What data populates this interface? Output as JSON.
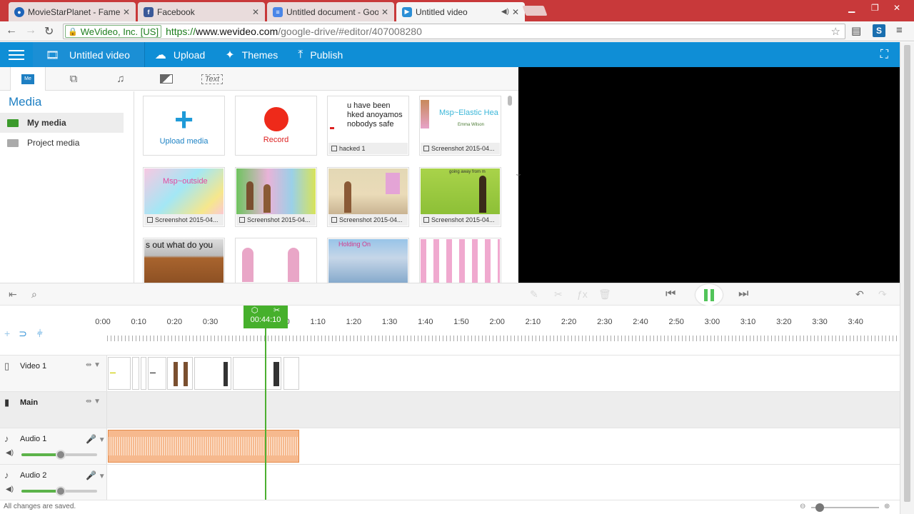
{
  "browser": {
    "tabs": [
      {
        "title": "MovieStarPlanet - Fame",
        "favicon_color": "#1e63b8"
      },
      {
        "title": "Facebook",
        "favicon_color": "#3b5998"
      },
      {
        "title": "Untitled document - Goo",
        "favicon_color": "#4a86e8"
      },
      {
        "title": "Untitled video",
        "favicon_color": "#2b8fd6"
      }
    ],
    "address": {
      "org": "WeVideo, Inc. [US]",
      "scheme": "https://",
      "host": "www.wevideo.com",
      "path": "/google-drive/#editor/407008280"
    },
    "ext_badge": "S"
  },
  "appbar": {
    "project_title": "Untitled video",
    "upload": "Upload",
    "themes": "Themes",
    "publish": "Publish",
    "color": "#0f8ed6"
  },
  "media_tabs": [
    "Me",
    "Text"
  ],
  "sidebar": {
    "heading": "Media",
    "items": [
      "My media",
      "Project media"
    ]
  },
  "media_grid": {
    "upload_label": "Upload media",
    "record_label": "Record",
    "items": [
      {
        "caption": "hacked 1",
        "text": "u have been hked anoyamos nobodys safe"
      },
      {
        "caption": "Screenshot 2015-04...",
        "text": "Msp~Elastic Hea",
        "sub": "Emma Wilson"
      },
      {
        "caption": "Screenshot 2015-04...",
        "text": "Msp~outside"
      },
      {
        "caption": "Screenshot 2015-04...",
        "text": ""
      },
      {
        "caption": "Screenshot 2015-04...",
        "text": ""
      },
      {
        "caption": "Screenshot 2015-04...",
        "text": "going away from m"
      },
      {
        "caption": "",
        "text": "s out what do you"
      },
      {
        "caption": "",
        "text": ""
      },
      {
        "caption": "",
        "text": "Holding On"
      },
      {
        "caption": "",
        "text": ""
      }
    ]
  },
  "timeline": {
    "playhead_time": "00:44:10",
    "ticks": [
      "0:00",
      "0:10",
      "0:20",
      "0:30",
      "0",
      "1:00",
      "1:10",
      "1:20",
      "1:30",
      "1:40",
      "1:50",
      "2:00",
      "2:10",
      "2:20",
      "2:30",
      "2:40",
      "2:50",
      "3:00",
      "3:10",
      "3:20",
      "3:30",
      "3:40"
    ],
    "tracks": [
      {
        "name": "Video 1"
      },
      {
        "name": "Main"
      },
      {
        "name": "Audio 1",
        "volume": 0.52
      },
      {
        "name": "Audio 2",
        "volume": 0.52
      }
    ]
  },
  "status": {
    "saved": "All changes are saved."
  }
}
